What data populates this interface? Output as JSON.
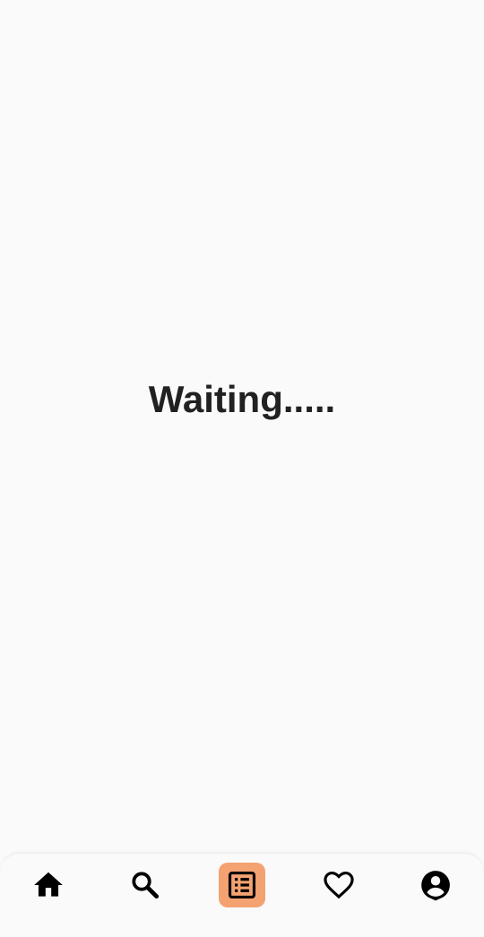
{
  "main": {
    "status_text": "Waiting....."
  },
  "bottom_nav": {
    "items": [
      {
        "icon": "home-icon",
        "active": false
      },
      {
        "icon": "search-icon",
        "active": false
      },
      {
        "icon": "list-icon",
        "active": true
      },
      {
        "icon": "heart-icon",
        "active": false
      },
      {
        "icon": "account-icon",
        "active": false
      }
    ],
    "active_color": "#f4a271"
  },
  "colors": {
    "background": "#fafafa",
    "text": "#212121",
    "icon": "#000000"
  }
}
